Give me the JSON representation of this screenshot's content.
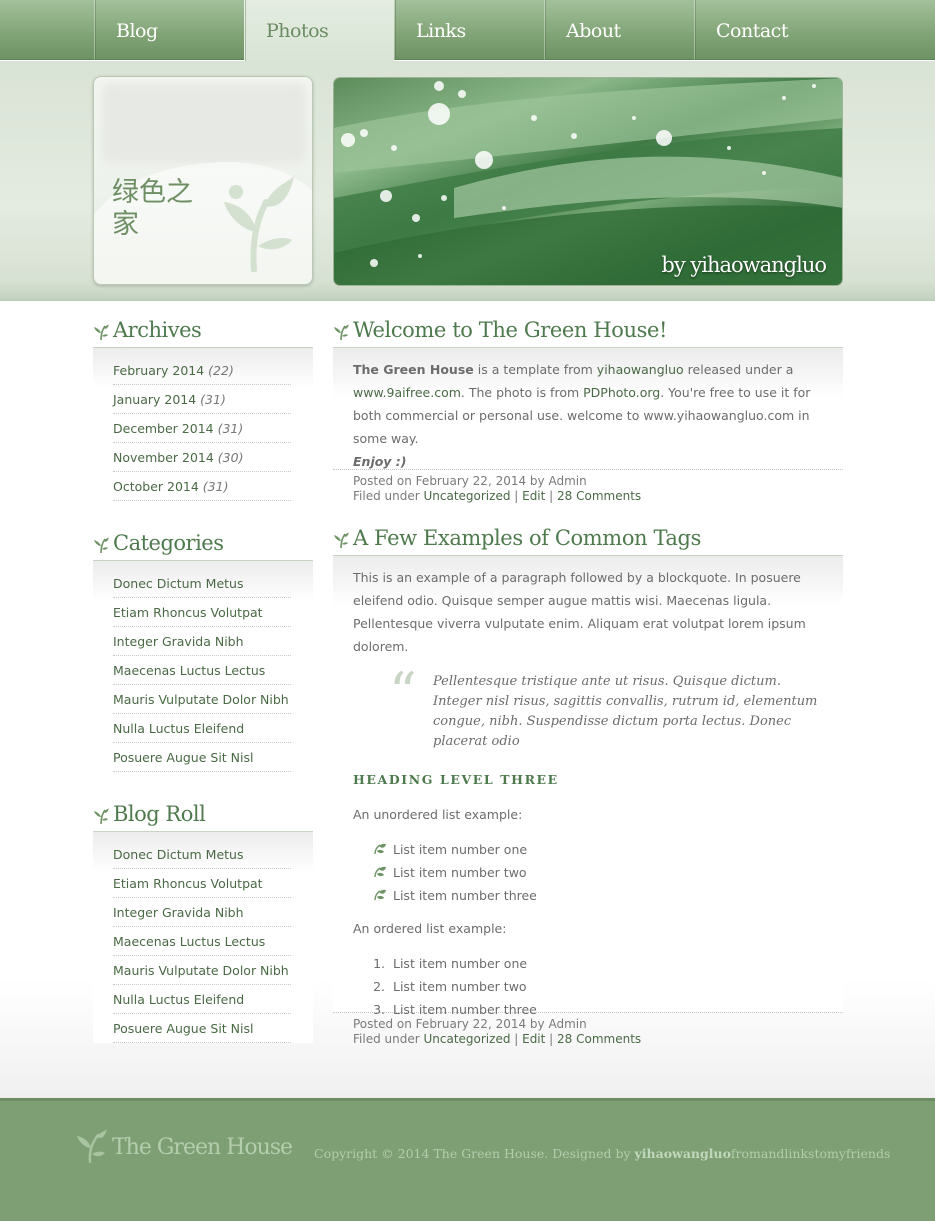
{
  "nav": {
    "tabs": [
      {
        "label": "Blog"
      },
      {
        "label": "Photos"
      },
      {
        "label": "Links"
      },
      {
        "label": "About"
      },
      {
        "label": "Contact"
      }
    ],
    "active": "Photos"
  },
  "header": {
    "logo_text": "绿色之家",
    "hero_credit": "by yihaowangluo"
  },
  "sidebar": {
    "archives": {
      "title": "Archives",
      "items": [
        {
          "label": "February 2014",
          "count": "(22)"
        },
        {
          "label": "January 2014",
          "count": "(31)"
        },
        {
          "label": "December 2014",
          "count": "(31)"
        },
        {
          "label": "November 2014",
          "count": "(30)"
        },
        {
          "label": "October 2014",
          "count": "(31)"
        }
      ]
    },
    "categories": {
      "title": "Categories",
      "items": [
        {
          "label": "Donec Dictum Metus"
        },
        {
          "label": "Etiam Rhoncus Volutpat"
        },
        {
          "label": "Integer Gravida Nibh"
        },
        {
          "label": "Maecenas Luctus Lectus"
        },
        {
          "label": "Mauris Vulputate Dolor Nibh"
        },
        {
          "label": "Nulla Luctus Eleifend"
        },
        {
          "label": "Posuere Augue Sit Nisl"
        }
      ]
    },
    "blogroll": {
      "title": "Blog Roll",
      "items": [
        {
          "label": "Donec Dictum Metus"
        },
        {
          "label": "Etiam Rhoncus Volutpat"
        },
        {
          "label": "Integer Gravida Nibh"
        },
        {
          "label": "Maecenas Luctus Lectus"
        },
        {
          "label": "Mauris Vulputate Dolor Nibh"
        },
        {
          "label": "Nulla Luctus Eleifend"
        },
        {
          "label": "Posuere Augue Sit Nisl"
        }
      ]
    }
  },
  "posts": [
    {
      "title": "Welcome to The Green House!",
      "intro": {
        "strong": "The Green House",
        "t1": " is a template from ",
        "link1": "yihaowangluo",
        "t2": " released under a ",
        "link2": "www.9aifree.com",
        "t3": ". The photo is from ",
        "link3": "PDPhoto.org",
        "t4": ". You're free to use it for both commercial or personal use. welcome to www.yihaowangluo.com in some way.",
        "enjoy": "Enjoy :)"
      },
      "meta": {
        "posted": "Posted on February 22, 2014 by Admin",
        "filed_prefix": "Filed under ",
        "category": "Uncategorized",
        "edit": "Edit",
        "comments": "28 Comments",
        "sep": " | "
      }
    },
    {
      "title": "A Few Examples of Common Tags",
      "paragraph": "This is an example of a paragraph followed by a blockquote. In posuere eleifend odio. Quisque semper augue mattis wisi. Maecenas ligula. Pellentesque viverra vulputate enim. Aliquam erat volutpat lorem ipsum dolorem.",
      "quote_mark": "“",
      "blockquote": "Pellentesque tristique ante ut risus. Quisque dictum. Integer nisl risus, sagittis convallis, rutrum id, elementum congue, nibh. Suspendisse dictum porta lectus. Donec placerat odio",
      "heading3": "HEADING LEVEL THREE",
      "ul_intro": "An unordered list example:",
      "ul": [
        "List item number one",
        "List item number two",
        "List item number three"
      ],
      "ol_intro": "An ordered list example:",
      "ol": [
        {
          "num": "1.",
          "label": "List item number one"
        },
        {
          "num": "2.",
          "label": "List item number two"
        },
        {
          "num": "3.",
          "label": "List item number three"
        }
      ],
      "meta": {
        "posted": "Posted on February 22, 2014 by Admin",
        "filed_prefix": "Filed under ",
        "category": "Uncategorized",
        "edit": "Edit",
        "comments": "28 Comments",
        "sep": " | "
      }
    }
  ],
  "footer": {
    "logo": "The Green House",
    "copyright": "Copyright © 2014 The Green House. Designed by ",
    "designer": "yihaowangluo",
    "tail": "fromandlinkstomyfriends"
  },
  "icons": {
    "section_leaf": "leaf-sprout-icon",
    "list_bullet": "leaf-bullet-icon"
  },
  "colors": {
    "brand_green": "#7d9f73",
    "title_green": "#4e7a4d",
    "link_green": "#4a6a45",
    "header_bg": "#dfe7dc"
  }
}
